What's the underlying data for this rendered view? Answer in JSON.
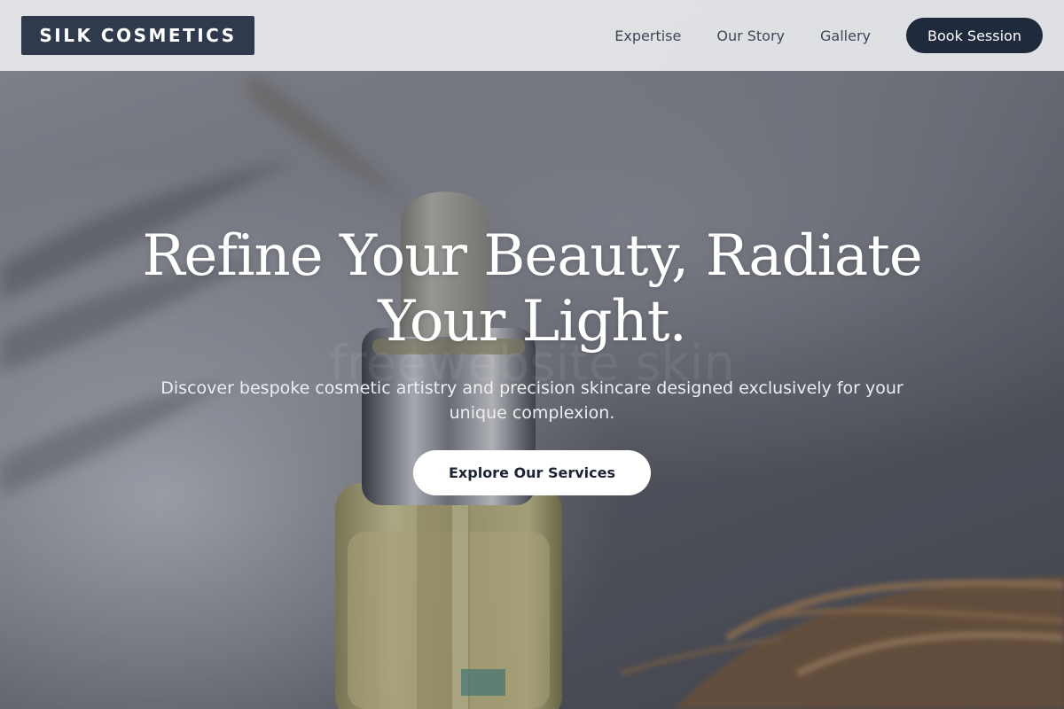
{
  "brand": {
    "name": "SILK COSMETICS"
  },
  "nav": {
    "links": [
      "Expertise",
      "Our Story",
      "Gallery"
    ],
    "book_label": "Book Session"
  },
  "hero": {
    "title": "Refine Your Beauty, Radiate Your Light.",
    "subtitle": "Discover bespoke cosmetic artistry and precision skincare designed exclusively for your unique complexion.",
    "cta_label": "Explore Our Services",
    "watermark": "freewebsite skin",
    "image_subject": "serum-dropper-bottle-photo"
  },
  "colors": {
    "logo_bg": "#2f3a4d",
    "book_button_bg": "#1f2a3c",
    "navbar_bg": "#e4e5e8",
    "cta_bg": "#ffffff"
  }
}
